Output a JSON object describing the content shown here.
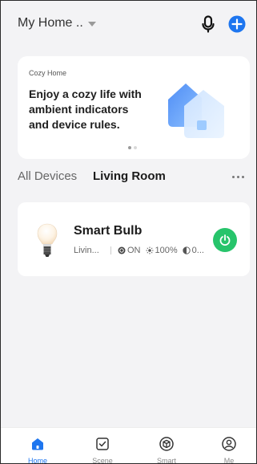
{
  "header": {
    "home_title": "My Home ..",
    "mic_icon": "microphone-icon",
    "add_icon": "plus-circle-icon",
    "accent": "#1e76ef"
  },
  "banner": {
    "eyebrow": "Cozy Home",
    "headline": "Enjoy a cozy life with\nambient indicators\nand device rules.",
    "page_count": 2,
    "active_page": 1
  },
  "tabs": {
    "all": "All Devices",
    "room": "Living Room",
    "active": "room"
  },
  "device": {
    "name": "Smart Bulb",
    "room": "Livin...",
    "power_state": "ON",
    "brightness": "100%",
    "extra": "0...",
    "power_color": "#27c46b"
  },
  "nav": {
    "items": [
      {
        "label": "Home",
        "icon": "home-icon",
        "active": true
      },
      {
        "label": "Scene",
        "icon": "scene-icon",
        "active": false
      },
      {
        "label": "Smart",
        "icon": "smart-cube-icon",
        "active": false
      },
      {
        "label": "Me",
        "icon": "profile-icon",
        "active": false
      }
    ]
  }
}
